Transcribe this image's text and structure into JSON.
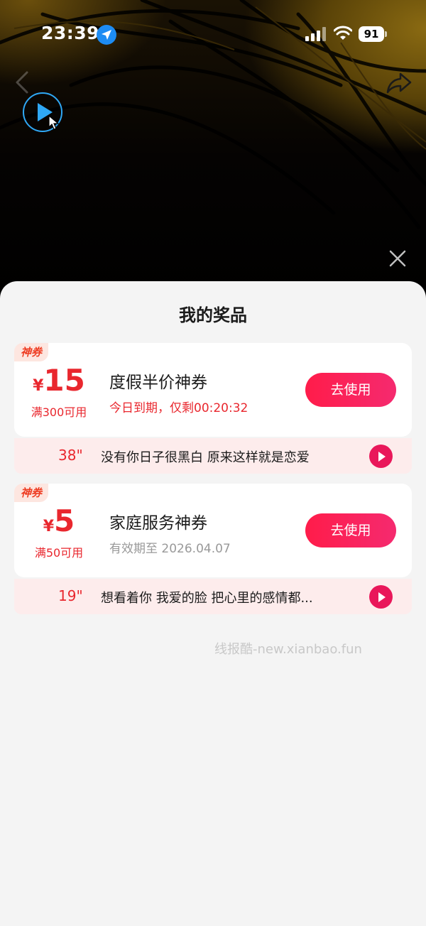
{
  "status_bar": {
    "time": "23:39",
    "battery": "91",
    "icons": [
      "location-arrow-icon",
      "signal-icon",
      "wifi-icon",
      "battery-icon"
    ]
  },
  "video": {
    "icons": [
      "back-chevron-icon",
      "share-arrow-icon",
      "play-icon",
      "cursor-icon",
      "close-icon"
    ]
  },
  "sheet": {
    "title": "我的奖品",
    "watermark": "线报酷-new.xianbao.fun"
  },
  "prizes": [
    {
      "badge": "神券",
      "currency": "¥",
      "amount": "15",
      "threshold": "满300可用",
      "name": "度假半价神券",
      "subtitle": "今日到期，仅剩00:20:32",
      "button": "去使用",
      "music": {
        "duration": "38\"",
        "lyric": "没有你日子很黑白 原来这样就是恋爱"
      }
    },
    {
      "badge": "神券",
      "currency": "¥",
      "amount": "5",
      "threshold": "满50可用",
      "name": "家庭服务神券",
      "subtitle": "有效期至 2026.04.07",
      "button": "去使用",
      "music": {
        "duration": "19\"",
        "lyric": "想看着你 我爱的脸 把心里的感情都..."
      }
    }
  ],
  "colors": {
    "accent_red": "#e9272e",
    "button_gradient_start": "#ff1c4a",
    "button_gradient_end": "#f52a6f",
    "location_blue": "#1d8cf3",
    "play_border": "#2fa8f5"
  }
}
